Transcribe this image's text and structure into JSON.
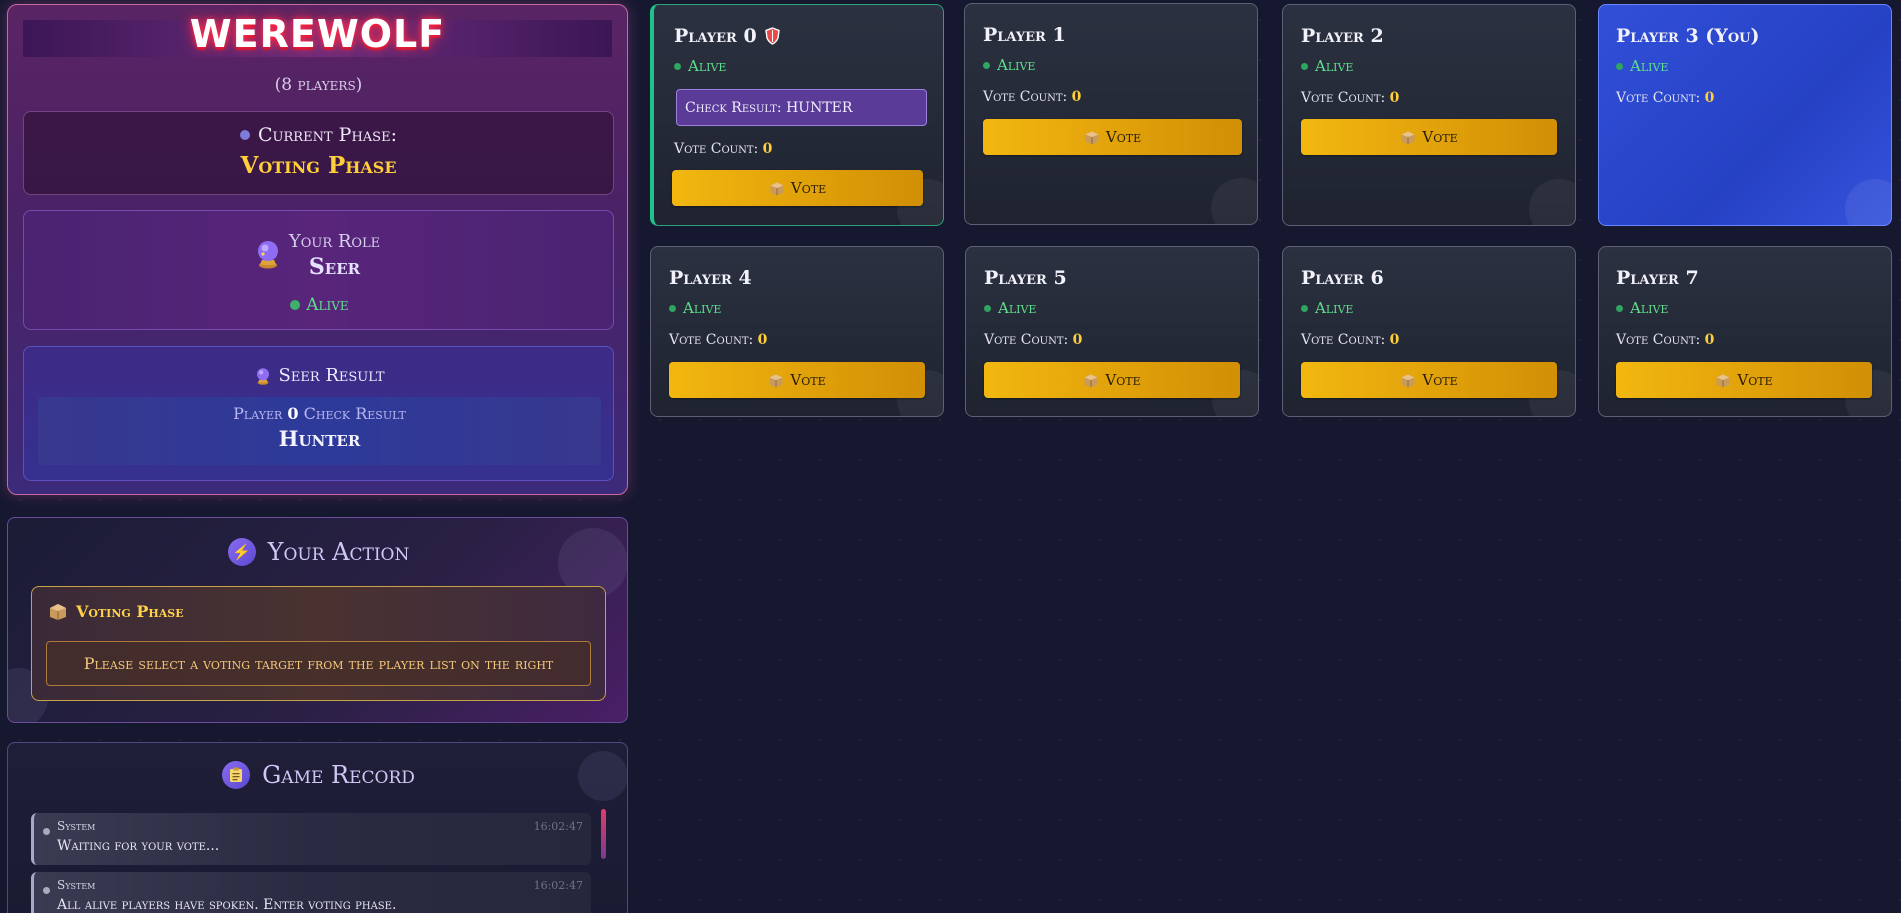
{
  "header": {
    "game_title": "WEREWOLF",
    "player_count": "(8 players)"
  },
  "phase": {
    "label": "Current Phase:",
    "value": "Voting Phase"
  },
  "role": {
    "label": "Your Role",
    "value": "Seer",
    "status": "Alive"
  },
  "seer_result": {
    "title": "Seer Result",
    "prefix": "Player",
    "player_number": "0",
    "suffix": "Check Result",
    "value": "Hunter"
  },
  "action": {
    "title": "Your Action",
    "box_title": "Voting Phase",
    "hint": "Please select a voting target from the player list on the right"
  },
  "record": {
    "title": "Game Record",
    "entries": [
      {
        "sender": "System",
        "time": "16:02:47",
        "text": "Waiting for your vote..."
      },
      {
        "sender": "System",
        "time": "16:02:47",
        "text": "All alive players have spoken. Enter voting phase."
      }
    ]
  },
  "players": [
    {
      "name": "Player 0",
      "status": "Alive",
      "check_result": "Check Result: HUNTER",
      "vote_label": "Vote Count:",
      "vote_count": "0",
      "button": "Vote"
    },
    {
      "name": "Player 1",
      "status": "Alive",
      "vote_label": "Vote Count:",
      "vote_count": "0",
      "button": "Vote"
    },
    {
      "name": "Player 2",
      "status": "Alive",
      "vote_label": "Vote Count:",
      "vote_count": "0",
      "button": "Vote"
    },
    {
      "name": "Player 3 (You)",
      "status": "Alive",
      "vote_label": "Vote Count:",
      "vote_count": "0"
    },
    {
      "name": "Player 4",
      "status": "Alive",
      "vote_label": "Vote Count:",
      "vote_count": "0",
      "button": "Vote"
    },
    {
      "name": "Player 5",
      "status": "Alive",
      "vote_label": "Vote Count:",
      "vote_count": "0",
      "button": "Vote"
    },
    {
      "name": "Player 6",
      "status": "Alive",
      "vote_label": "Vote Count:",
      "vote_count": "0",
      "button": "Vote"
    },
    {
      "name": "Player 7",
      "status": "Alive",
      "vote_label": "Vote Count:",
      "vote_count": "0",
      "button": "Vote"
    }
  ],
  "icons": {
    "phase": "phase-dot-icon",
    "role": "crystal-ball-icon",
    "seer": "crystal-ball-icon",
    "action": "lightning-icon",
    "voting": "ballot-box-icon",
    "record": "clipboard-icon",
    "protected": "shield-icon"
  },
  "colors": {
    "accent_gold": "#ffcf3a",
    "alive_green": "#5ee08b",
    "you_blue": "#2f4ed6",
    "vote_button": "#f2b70f"
  }
}
